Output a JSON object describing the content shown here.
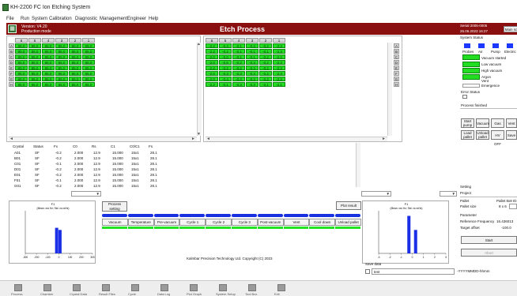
{
  "window": {
    "title": "KH-2200 FC Ion Etching System"
  },
  "menu": [
    "File",
    "Run",
    "System",
    "Calibration",
    "Diagnostic",
    "Management",
    "Engineer",
    "Help"
  ],
  "header": {
    "version": "Version: V4.20",
    "mode": "Production mode",
    "title": "Etch Process",
    "serial": "Serial 2005-0005",
    "datetime": "26.06.2023 16:27",
    "main_button": "Main screen"
  },
  "left_grid": {
    "columns": [
      "6",
      "5",
      "4",
      "3",
      "2",
      "1"
    ],
    "rows": [
      "A",
      "B",
      "C",
      "D",
      "E",
      "F",
      "G",
      "H"
    ],
    "values": [
      [
        "85.0",
        "85.0",
        "85.0",
        "85.0",
        "85.0",
        "85.0"
      ],
      [
        "85.0",
        "85.0",
        "85.0",
        "85.0",
        "85.0",
        "85.0"
      ],
      [
        "85.0",
        "85.0",
        "85.0",
        "85.0",
        "85.0",
        "85.0"
      ],
      [
        "85.0",
        "85.0",
        "85.0",
        "85.0",
        "85.0",
        "85.0"
      ],
      [
        "85.0",
        "85.0",
        "85.0",
        "85.0",
        "85.0",
        "85.0"
      ],
      [
        "85.0",
        "85.0",
        "85.0",
        "85.0",
        "85.0",
        "85.0"
      ],
      [
        "85.0",
        "85.0",
        "85.0",
        "85.0",
        "85.0",
        "85.0"
      ],
      [
        "85.0",
        "85.0",
        "85.0",
        "85.0",
        "85.0",
        "85.0"
      ]
    ]
  },
  "right_grid": {
    "columns": [
      "6",
      "5",
      "4",
      "3",
      "2",
      "1"
    ],
    "rows": [
      "A",
      "B",
      "C",
      "D",
      "E",
      "F",
      "G",
      "H"
    ],
    "values": [
      [
        "-2.2",
        "-0.4",
        "-0.1",
        "-0.3",
        "-0.2",
        "-2.3"
      ],
      [
        "-2.2",
        "-0.2",
        "-0.1",
        "-0.1",
        "-0.1",
        "-2.3"
      ],
      [
        "-2.0",
        "-0.0",
        "-0.1",
        "-0.1",
        "-0.2",
        "-2.3"
      ],
      [
        "-2.0",
        "-0.6",
        "-0.2",
        "-0.3",
        "-0.2",
        "-2.3"
      ],
      [
        "-2.2",
        "-0.2",
        "-0.2",
        "-0.3",
        "-0.2",
        "-2.3"
      ],
      [
        "-2.0",
        "-0.3",
        "-0.3",
        "-0.3",
        "-0.2",
        "-2.3"
      ],
      [
        "-2.0",
        "-0.4",
        "-0.4",
        "-0.3",
        "-0.2",
        "-2.3"
      ],
      [
        "-2.2",
        "-0.1",
        "-0.3",
        "-0.3",
        "-0.1",
        "-2.1"
      ]
    ]
  },
  "crystal_table": {
    "headers": [
      "Crystal",
      "Status",
      "Fx",
      "C0",
      "Rs",
      "C1",
      "C0/C1",
      "Fs"
    ],
    "rows": [
      [
        "A01",
        "SF",
        "-0.2",
        "2.000",
        "12.9",
        "15.000",
        "15x1",
        "28.1"
      ],
      [
        "B01",
        "SF",
        "-0.2",
        "2.000",
        "12.9",
        "15.000",
        "15x1",
        "28.1"
      ],
      [
        "C01",
        "SF",
        "-0.1",
        "2.000",
        "12.9",
        "15.000",
        "15x1",
        "28.1"
      ],
      [
        "D01",
        "SF",
        "-0.2",
        "2.000",
        "12.9",
        "15.000",
        "15x1",
        "28.1"
      ],
      [
        "E01",
        "SF",
        "-0.2",
        "2.000",
        "12.9",
        "15.000",
        "15x1",
        "28.1"
      ],
      [
        "F01",
        "SF",
        "-0.1",
        "2.000",
        "12.9",
        "15.000",
        "15x1",
        "28.1"
      ],
      [
        "G01",
        "SF",
        "-0.2",
        "2.000",
        "12.9",
        "15.000",
        "15x1",
        "28.1"
      ]
    ]
  },
  "system_status": {
    "label": "System Status",
    "indicators": [
      "Probes",
      "Air",
      "Pump",
      "Electric"
    ],
    "legend": [
      "Vacuum started",
      "Low vacuum",
      "High vacuum",
      "Argon",
      "Vent",
      "Emergence"
    ],
    "error_label": "Error Status",
    "process_label": "Process finished"
  },
  "buttons": {
    "start_pump": "Start pump",
    "vacuum": "Vacuum",
    "gas": "Gas",
    "vent": "Vent",
    "load_pallet": "Load pallet",
    "unload_pallet": "Unload pallet",
    "hv_off": "HV OFF",
    "save": "Save",
    "process_setting": "Process setting",
    "plot_result": "Plot result",
    "start": "Start",
    "abort": "Abort"
  },
  "process_steps": [
    "Vacuum",
    "Temperature",
    "Pre-vacuum",
    "Cycle 1",
    "Cycle 2",
    "Cycle 3",
    "Post-vacuum",
    "Vent",
    "Cool down",
    "Unload pallet"
  ],
  "setting": {
    "label": "Setting",
    "project_label": "Project",
    "pallet_label": "Pallet",
    "pallet_value": "Pallet 8x8 ID",
    "pallet_size_label": "Pallet size",
    "pallet_size_value": "8 x 6",
    "param_label": "Parameter",
    "ref_freq_label": "Reference Frequency",
    "ref_freq_value": "16.436013",
    "target_offset_label": "Target offset",
    "target_offset_value": "-100.0"
  },
  "footer": {
    "copyright": "Kalmbar Precision Technology Ltd. Copyright (C) 2023",
    "save_data_label": "Save data",
    "save_data_value": "test",
    "serial_code": "-YYYYMMDD-hhmm"
  },
  "chart_data": [
    {
      "type": "bar",
      "title": "F1",
      "subtitle": "(Mean: xxx Hz; Std: xx.xxHz)",
      "x": [
        -30,
        -20,
        -10,
        0,
        10,
        20,
        30
      ],
      "xticks": [
        "-300",
        "-200",
        "-100",
        "0",
        "100",
        "200",
        "300"
      ],
      "bars": [
        {
          "x": -2,
          "value": 60
        },
        {
          "x": 1,
          "value": 55
        }
      ],
      "ylim": [
        0,
        100
      ]
    },
    {
      "type": "bar",
      "title": "F1",
      "subtitle": "(Mean: xxx Hz; Std: xx.xxHz)",
      "xticks": [
        "-3",
        "-2",
        "-1",
        "0",
        "1",
        "2",
        "3"
      ],
      "bars": [
        {
          "x": -0.3,
          "value": 88
        },
        {
          "x": 0.3,
          "value": 55
        }
      ],
      "ylim": [
        0,
        100
      ]
    }
  ],
  "toolbar": [
    "Process",
    "Chamber",
    "Crystal Data",
    "Result Files",
    "Cycle",
    "Data Log",
    "Plot Graph",
    "System Setup",
    "Tool Box",
    "Exit"
  ]
}
